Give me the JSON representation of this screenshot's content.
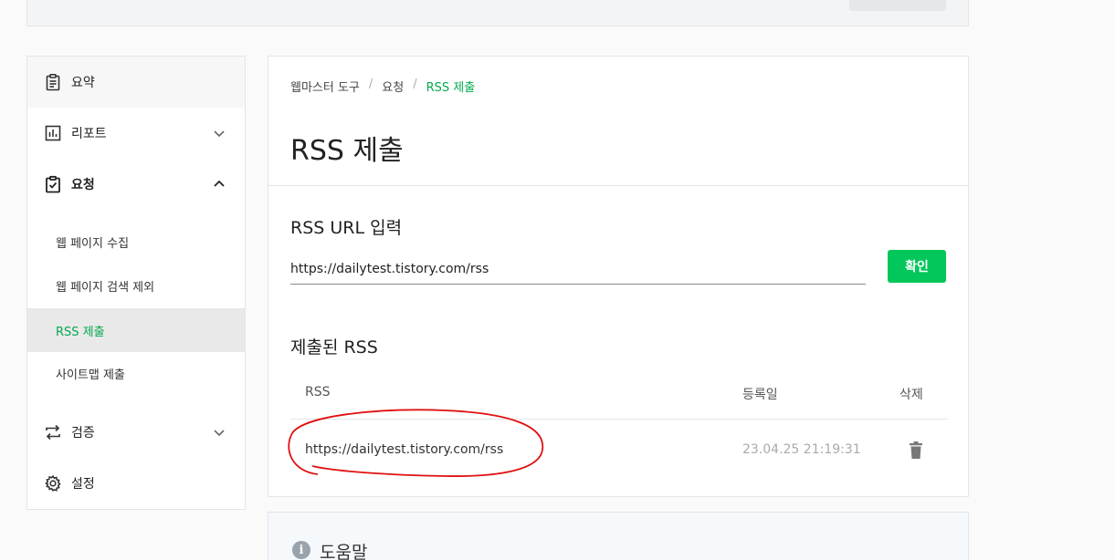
{
  "sidebar": {
    "items": [
      {
        "label": "요약",
        "icon": "clipboard-icon"
      },
      {
        "label": "리포트",
        "icon": "bar-chart-icon"
      },
      {
        "label": "요청",
        "icon": "clipboard-check-icon"
      },
      {
        "label": "검증",
        "icon": "repeat-icon"
      },
      {
        "label": "설정",
        "icon": "gear-icon"
      }
    ],
    "sub_items": [
      {
        "label": "웹 페이지 수집"
      },
      {
        "label": "웹 페이지 검색 제외"
      },
      {
        "label": "RSS 제출"
      },
      {
        "label": "사이트맵 제출"
      }
    ]
  },
  "breadcrumb": {
    "root": "웹마스터 도구",
    "mid": "요청",
    "current": "RSS 제출",
    "separator": "/"
  },
  "page": {
    "title": "RSS 제출"
  },
  "rss_input": {
    "label": "RSS URL 입력",
    "value": "https://dailytest.tistory.com/rss",
    "button": "확인"
  },
  "submitted": {
    "title": "제출된 RSS",
    "columns": [
      "RSS",
      "등록일",
      "삭제"
    ],
    "rows": [
      {
        "url": "https://dailytest.tistory.com/rss",
        "date": "23.04.25 21:19:31"
      }
    ]
  },
  "help": {
    "title": "도움말",
    "icon_glyph": "i"
  },
  "colors": {
    "accent": "#03c75a",
    "accent_text": "#03a94d",
    "annotation": "#e01010"
  }
}
